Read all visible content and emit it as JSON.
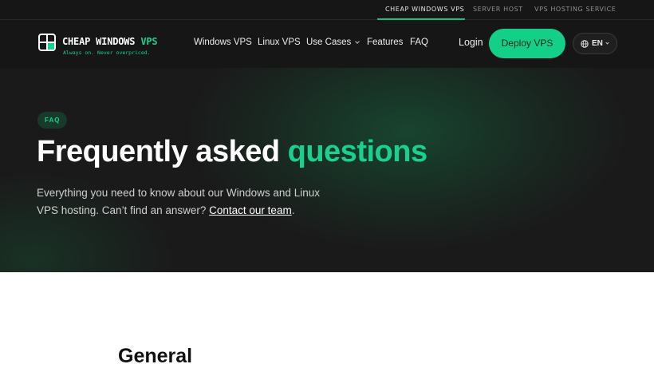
{
  "topbar": {
    "links": [
      {
        "label": "CHEAP WINDOWS VPS",
        "active": true
      },
      {
        "label": "SERVER HOST",
        "active": false
      },
      {
        "label": "VPS HOSTING SERVICE",
        "active": false
      }
    ]
  },
  "header": {
    "logo": {
      "name_main": "CHEAP WINDOWS",
      "name_accent": "VPS",
      "tagline": "Always on. Never overpriced.",
      "icon": "windows-grid-icon"
    },
    "nav": [
      {
        "label": "Windows VPS"
      },
      {
        "label": "Linux VPS"
      },
      {
        "label": "Use Cases",
        "has_dropdown": true
      },
      {
        "label": "Features"
      },
      {
        "label": "FAQ"
      }
    ],
    "login_label": "Login",
    "deploy_label": "Deploy VPS",
    "language": {
      "label": "EN",
      "icon": "globe-icon"
    }
  },
  "hero": {
    "badge": "FAQ",
    "title_main": "Frequently asked",
    "title_accent": "questions",
    "description_pre": "Everything you need to know about our Windows and Linux VPS hosting. Can’t find an answer?",
    "description_link": "Contact our team",
    "description_post": "."
  },
  "section": {
    "title": "General"
  },
  "colors": {
    "accent": "#18d18e",
    "dark_bg": "#161616",
    "button_bg": "#14cf88"
  }
}
